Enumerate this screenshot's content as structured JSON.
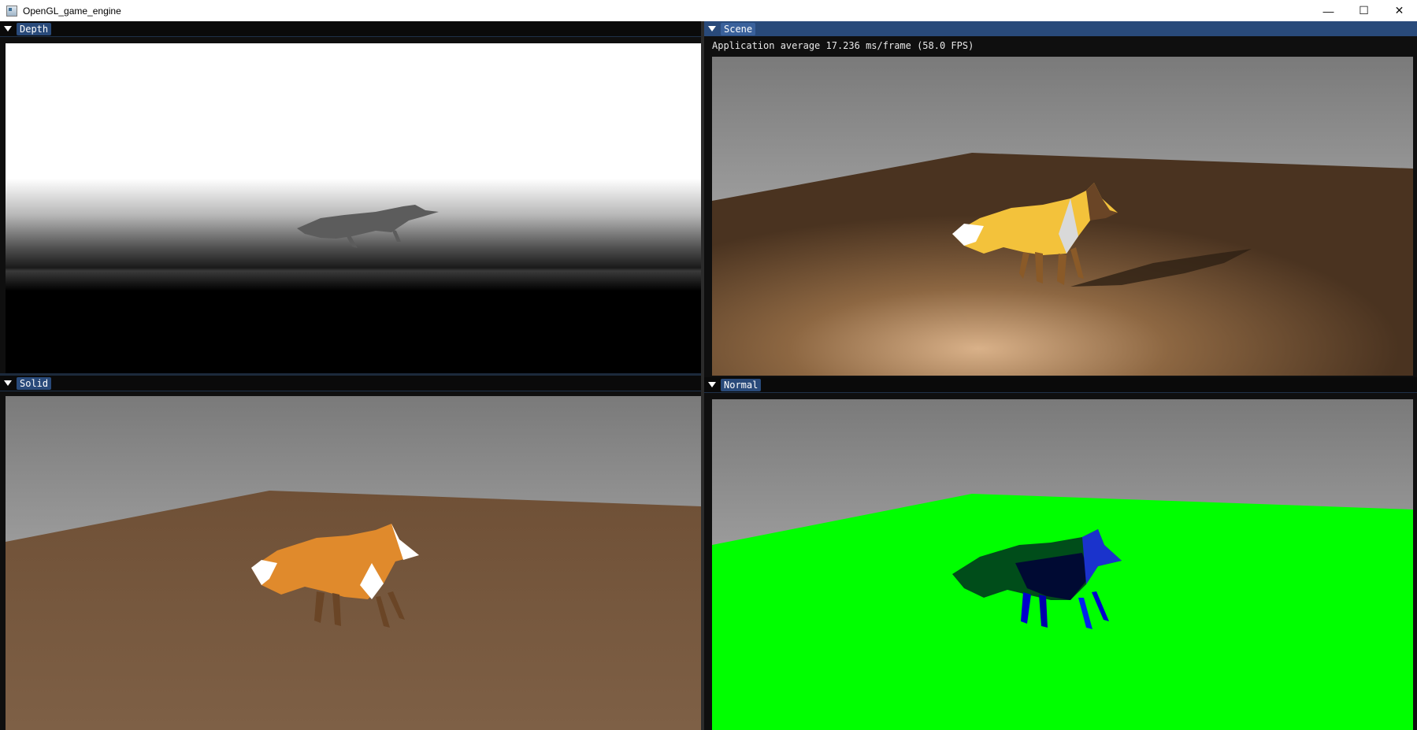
{
  "window": {
    "title": "OpenGL_game_engine",
    "controls": {
      "minimize": "—",
      "maximize": "☐",
      "close": "✕"
    }
  },
  "panels": {
    "depth": {
      "label": "Depth"
    },
    "scene": {
      "label": "Scene",
      "stats": "Application average 17.236 ms/frame (58.0 FPS)"
    },
    "solid": {
      "label": "Solid"
    },
    "normal": {
      "label": "Normal"
    }
  },
  "colors": {
    "header_active": "#294a7a",
    "tab": "#294a7a",
    "normal_floor": "#00ff00",
    "fox_orange": "#e08a2c",
    "fox_yellow": "#f3c23b",
    "wood": "#6b4a2e"
  },
  "icons": [
    "app-icon",
    "collapse-arrow-icon",
    "minimize-icon",
    "maximize-icon",
    "close-icon"
  ]
}
